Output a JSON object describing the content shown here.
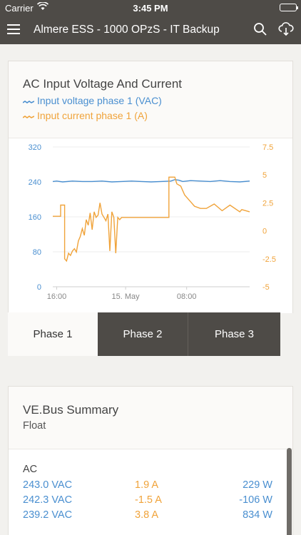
{
  "status_bar": {
    "carrier": "Carrier",
    "time": "3:45 PM"
  },
  "nav": {
    "title": "Almere ESS - 1000 OPzS - IT Backup",
    "menu_icon": "hamburger-menu-icon",
    "search_icon": "search-icon",
    "download_icon": "cloud-download-icon"
  },
  "colors": {
    "voltage": "#4a8fd0",
    "current": "#f0a33a",
    "header": "#4e4b47"
  },
  "chart_card": {
    "title": "AC Input Voltage And Current",
    "legend": [
      {
        "label": "Input voltage phase 1 (VAC)",
        "color": "#4a8fd0"
      },
      {
        "label": "Input current phase 1 (A)",
        "color": "#f0a33a"
      }
    ]
  },
  "chart_data": {
    "type": "line",
    "x_ticks": [
      "16:00",
      "15. May",
      "08:00"
    ],
    "y_left": {
      "ticks": [
        "320",
        "240",
        "160",
        "80",
        "0"
      ],
      "range": [
        0,
        320
      ]
    },
    "y_right": {
      "ticks": [
        "7.5",
        "5",
        "2.5",
        "0",
        "-2.5",
        "-5"
      ],
      "range": [
        -5,
        7.5
      ]
    },
    "grid": true,
    "legend_placement": "top-left",
    "series": [
      {
        "name": "Input voltage phase 1 (VAC)",
        "axis": "left",
        "x": [
          0,
          0.02,
          0.05,
          0.1,
          0.15,
          0.2,
          0.25,
          0.3,
          0.35,
          0.4,
          0.45,
          0.5,
          0.55,
          0.6,
          0.62,
          0.64,
          0.66,
          0.7,
          0.75,
          0.8,
          0.85,
          0.9,
          0.95,
          1.0
        ],
        "values": [
          241,
          242,
          240,
          242,
          241,
          241,
          242,
          240,
          241,
          242,
          241,
          240,
          241,
          242,
          245,
          244,
          241,
          243,
          242,
          241,
          243,
          241,
          240,
          242
        ]
      },
      {
        "name": "Input current phase 1 (A)",
        "axis": "right",
        "x": [
          0,
          0.04,
          0.04,
          0.06,
          0.06,
          0.07,
          0.08,
          0.09,
          0.1,
          0.11,
          0.12,
          0.13,
          0.14,
          0.15,
          0.16,
          0.17,
          0.18,
          0.19,
          0.2,
          0.21,
          0.22,
          0.23,
          0.24,
          0.25,
          0.26,
          0.27,
          0.28,
          0.29,
          0.3,
          0.31,
          0.32,
          0.33,
          0.34,
          0.35,
          0.59,
          0.59,
          0.62,
          0.63,
          0.65,
          0.67,
          0.7,
          0.72,
          0.75,
          0.78,
          0.82,
          0.86,
          0.9,
          0.95,
          0.96,
          1.0
        ],
        "values": [
          1.3,
          1.3,
          2.3,
          2.3,
          -2.5,
          -2.7,
          -2.0,
          -2.2,
          -1.8,
          -1.6,
          -1.9,
          -0.9,
          -0.5,
          0.2,
          -0.4,
          1.0,
          0.5,
          1.6,
          0.1,
          1.7,
          1.2,
          1.4,
          2.5,
          1.5,
          1.2,
          0.9,
          1.5,
          -1.8,
          1.7,
          1.2,
          -2.0,
          1.2,
          1.0,
          1.2,
          1.2,
          4.8,
          4.8,
          4.2,
          4.0,
          3.2,
          2.6,
          2.2,
          2.0,
          2.0,
          2.4,
          1.8,
          2.3,
          1.7,
          1.9,
          1.7
        ]
      }
    ]
  },
  "tabs": [
    {
      "label": "Phase 1"
    },
    {
      "label": "Phase 2"
    },
    {
      "label": "Phase 3"
    }
  ],
  "summary": {
    "title": "VE.Bus Summary",
    "state": "Float",
    "section_label": "AC",
    "rows": [
      {
        "voltage": "243.0 VAC",
        "current": "1.9 A",
        "power": "229 W"
      },
      {
        "voltage": "242.3 VAC",
        "current": "-1.5 A",
        "power": "-106 W"
      },
      {
        "voltage": "239.2 VAC",
        "current": "3.8 A",
        "power": "834 W"
      }
    ]
  }
}
